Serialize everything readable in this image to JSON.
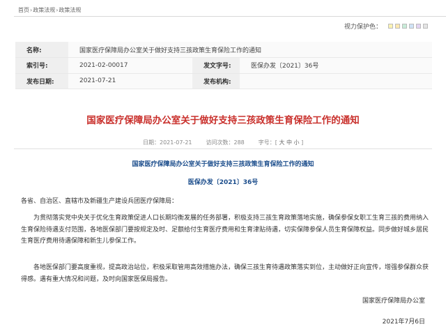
{
  "breadcrumb": {
    "items": [
      "首页",
      "政策法规",
      "政策法规"
    ],
    "sep": "›"
  },
  "color_protect": {
    "label": "视力保护色：",
    "swatches": [
      "#fbf3b2",
      "#fde8b0",
      "#c8ecd8",
      "#cfe2f6",
      "#e3d4f2",
      "#e4e4e4"
    ]
  },
  "info": {
    "name_key": "名称:",
    "name_value": "国家医疗保障局办公室关于做好支持三孩政策生育保险工作的通知",
    "index_key": "索引号:",
    "index_value": "2021-02-00017",
    "docno_key": "发文字号:",
    "docno_value": "医保办发〔2021〕36号",
    "date_key": "发布日期:",
    "date_value": "2021-07-21",
    "org_key": "发布机构:",
    "org_value": ""
  },
  "article": {
    "title": "国家医疗保障局办公室关于做好支持三孩政策生育保险工作的通知",
    "meta_date_label": "日期：",
    "meta_date": "2021-07-21",
    "meta_views_label": "访问次数：",
    "meta_views": "288",
    "meta_font_label": "字号：",
    "meta_font_open": "[",
    "meta_font_large": "大",
    "meta_font_medium": "中",
    "meta_font_small": "小",
    "meta_font_close": "]",
    "inner_title": "国家医疗保障局办公室关于做好支持三孩政策生育保险工作的通知",
    "doc_number": "医保办发〔2021〕36号",
    "addressees": "各省、自治区、直辖市及新疆生产建设兵团医疗保障局：",
    "para1": "为贯彻落实党中央关于优化生育政策促进人口长期均衡发展的任务部署，积极支持三孩生育政策落地实施，确保参保女职工生育三孩的费用纳入生育保险待遇支付范围，各地医保部门要按规定及时、足额给付生育医疗费用和生育津贴待遇，切实保障参保人员生育保障权益。同步做好城乡居民生育医疗费用待遇保障和新生儿参保工作。",
    "para2": "各地医保部门要高度重视，提高政治站位，积极采取管用高效措施办法，确保三孩生育待遇政策落实到位，主动做好正向宣传，增强参保群众获得感。遇有重大情况和问题，及时向国家医保局报告。",
    "signature": "国家医疗保障局办公室",
    "sign_date": "2021年7月6日"
  }
}
